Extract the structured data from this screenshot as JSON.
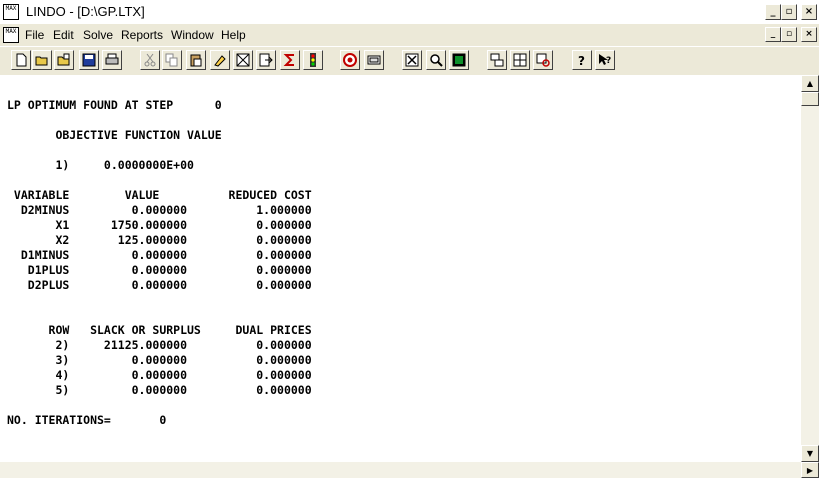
{
  "window": {
    "title": "LINDO - [D:\\GP.LTX]",
    "app_icon_text": "MAX",
    "minimize_label": "_",
    "restore_label": "▫",
    "close_label": "×"
  },
  "menu": {
    "doc_icon_text": "MAX",
    "items": [
      "File",
      "Edit",
      "Solve",
      "Reports",
      "Window",
      "Help"
    ],
    "minimize_label": "_",
    "restore_label": "▫",
    "close_label": "×"
  },
  "toolbar": {
    "icons": [
      "new-file-icon",
      "open-file-icon",
      "open-view-icon",
      "save-icon",
      "print-icon",
      "cut-icon",
      "copy-icon",
      "paste-icon",
      "paint-icon",
      "clear-icon",
      "go-to-icon",
      "sum-icon",
      "traffic-light-icon",
      "target-icon",
      "options-icon",
      "close-all-icon",
      "zoom-icon",
      "picture-icon",
      "tile-icon",
      "cascade-icon",
      "arrange-icon",
      "help-icon",
      "context-help-icon"
    ]
  },
  "report": {
    "lines": [
      "LP OPTIMUM FOUND AT STEP      0",
      "",
      "       OBJECTIVE FUNCTION VALUE",
      "",
      "       1)     0.0000000E+00",
      "",
      " VARIABLE        VALUE          REDUCED COST",
      "  D2MINUS         0.000000          1.000000",
      "       X1      1750.000000          0.000000",
      "       X2       125.000000          0.000000",
      "  D1MINUS         0.000000          0.000000",
      "   D1PLUS         0.000000          0.000000",
      "   D2PLUS         0.000000          0.000000",
      "",
      "",
      "      ROW   SLACK OR SURPLUS     DUAL PRICES",
      "       2)     21125.000000          0.000000",
      "       3)         0.000000          0.000000",
      "       4)         0.000000          0.000000",
      "       5)         0.000000          0.000000",
      "",
      "NO. ITERATIONS=       0"
    ]
  },
  "scrollbar": {
    "up_label": "▲",
    "down_label": "▼",
    "right_label": "▶"
  }
}
